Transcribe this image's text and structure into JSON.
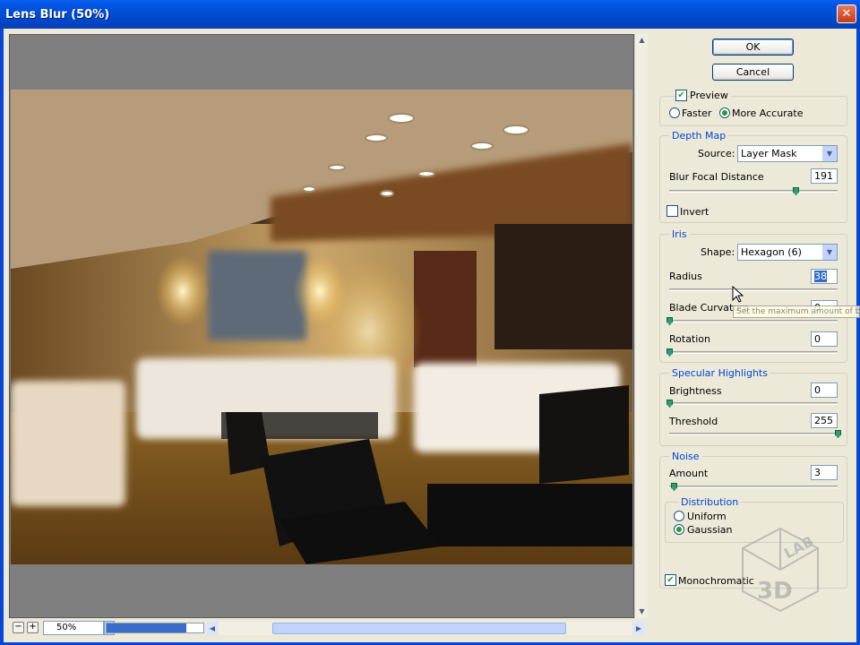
{
  "window": {
    "title": "Lens Blur (50%)",
    "close_glyph": "✕"
  },
  "buttons": {
    "ok": "OK",
    "cancel": "Cancel"
  },
  "preview": {
    "preview_label": "Preview",
    "preview_checked": true,
    "faster_label": "Faster",
    "more_accurate_label": "More Accurate",
    "selected": "More Accurate"
  },
  "depth_map": {
    "legend": "Depth Map",
    "source_label": "Source:",
    "source_value": "Layer Mask",
    "focal_label": "Blur Focal Distance",
    "focal_value": "191",
    "focal_level": 0.75,
    "invert_label": "Invert",
    "invert_checked": false
  },
  "iris": {
    "legend": "Iris",
    "shape_label": "Shape:",
    "shape_value": "Hexagon (6)",
    "radius_label": "Radius",
    "radius_value": "38",
    "curvature_label": "Blade Curvature",
    "curvature_value": "0",
    "rotation_label": "Rotation",
    "rotation_value": "0"
  },
  "specular": {
    "legend": "Specular Highlights",
    "brightness_label": "Brightness",
    "brightness_value": "0",
    "threshold_label": "Threshold",
    "threshold_value": "255"
  },
  "noise": {
    "legend": "Noise",
    "amount_label": "Amount",
    "amount_value": "3",
    "distribution_legend": "Distribution",
    "uniform_label": "Uniform",
    "gaussian_label": "Gaussian",
    "selected": "Gaussian",
    "mono_label": "Monochromatic",
    "mono_checked": true
  },
  "tooltip": "Set the maximum amount of blur",
  "bottom": {
    "zoom_value": "50%",
    "minus": "−",
    "plus": "+"
  },
  "watermark": {
    "text": "3D LAB"
  },
  "colors": {
    "titlebar": "#0054e3",
    "accent": "#0046d5",
    "panel_bg": "#ece9d8"
  },
  "icons": {
    "close": "close-icon",
    "dropdown": "chevron-down-icon",
    "check": "checkmark-icon"
  }
}
